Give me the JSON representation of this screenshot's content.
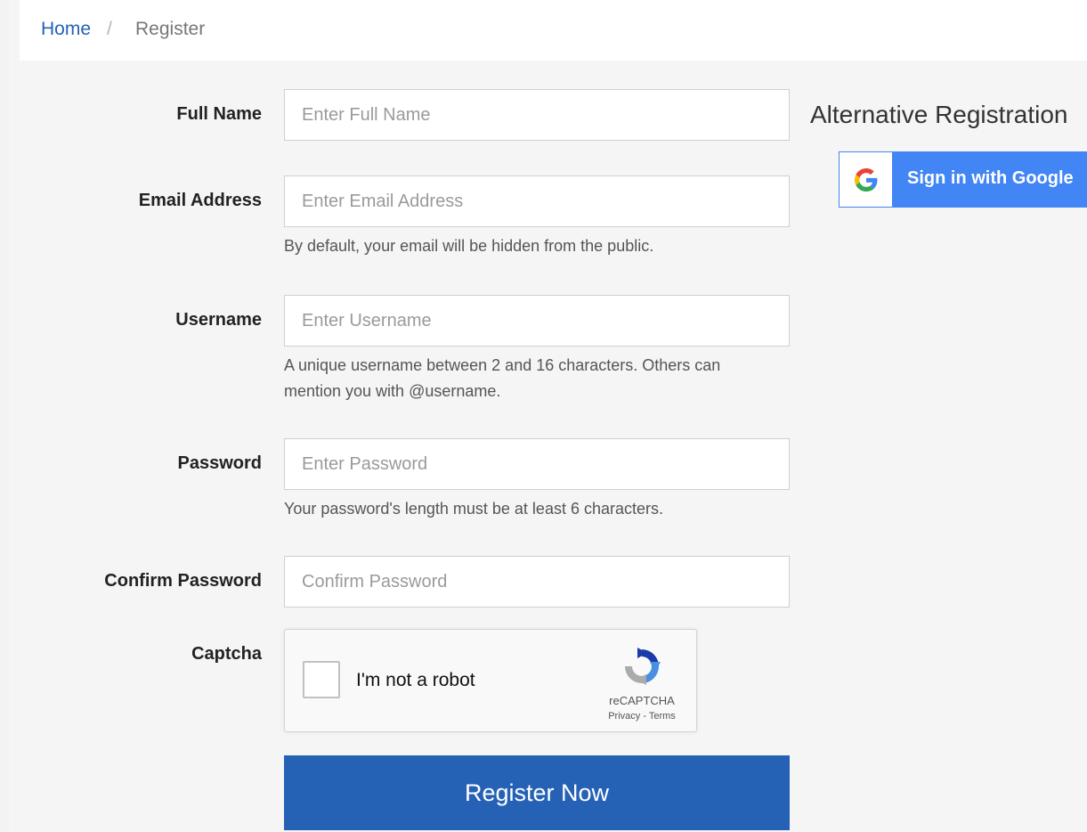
{
  "breadcrumb": {
    "home": "Home",
    "separator": "/",
    "current": "Register"
  },
  "form": {
    "full_name": {
      "label": "Full Name",
      "placeholder": "Enter Full Name",
      "value": ""
    },
    "email": {
      "label": "Email Address",
      "placeholder": "Enter Email Address",
      "value": "",
      "help": "By default, your email will be hidden from the public."
    },
    "username": {
      "label": "Username",
      "placeholder": "Enter Username",
      "value": "",
      "help_line1": "A unique username between 2 and 16 characters. Others can",
      "help_line2": "mention you with @username."
    },
    "password": {
      "label": "Password",
      "placeholder": "Enter Password",
      "value": "",
      "help": "Your password's length must be at least 6 characters."
    },
    "confirm_password": {
      "label": "Confirm Password",
      "placeholder": "Confirm Password",
      "value": ""
    },
    "captcha": {
      "label": "Captcha",
      "checkbox_text": "I'm not a robot",
      "brand": "reCAPTCHA",
      "privacy": "Privacy",
      "link_separator": " - ",
      "terms": "Terms"
    },
    "submit_label": "Register Now"
  },
  "alternative": {
    "title": "Alternative Registration",
    "google_button_label": "Sign in with Google",
    "google_icon": "google-g-icon"
  },
  "colors": {
    "primary": "#2562b6",
    "google_blue": "#4285f4"
  }
}
